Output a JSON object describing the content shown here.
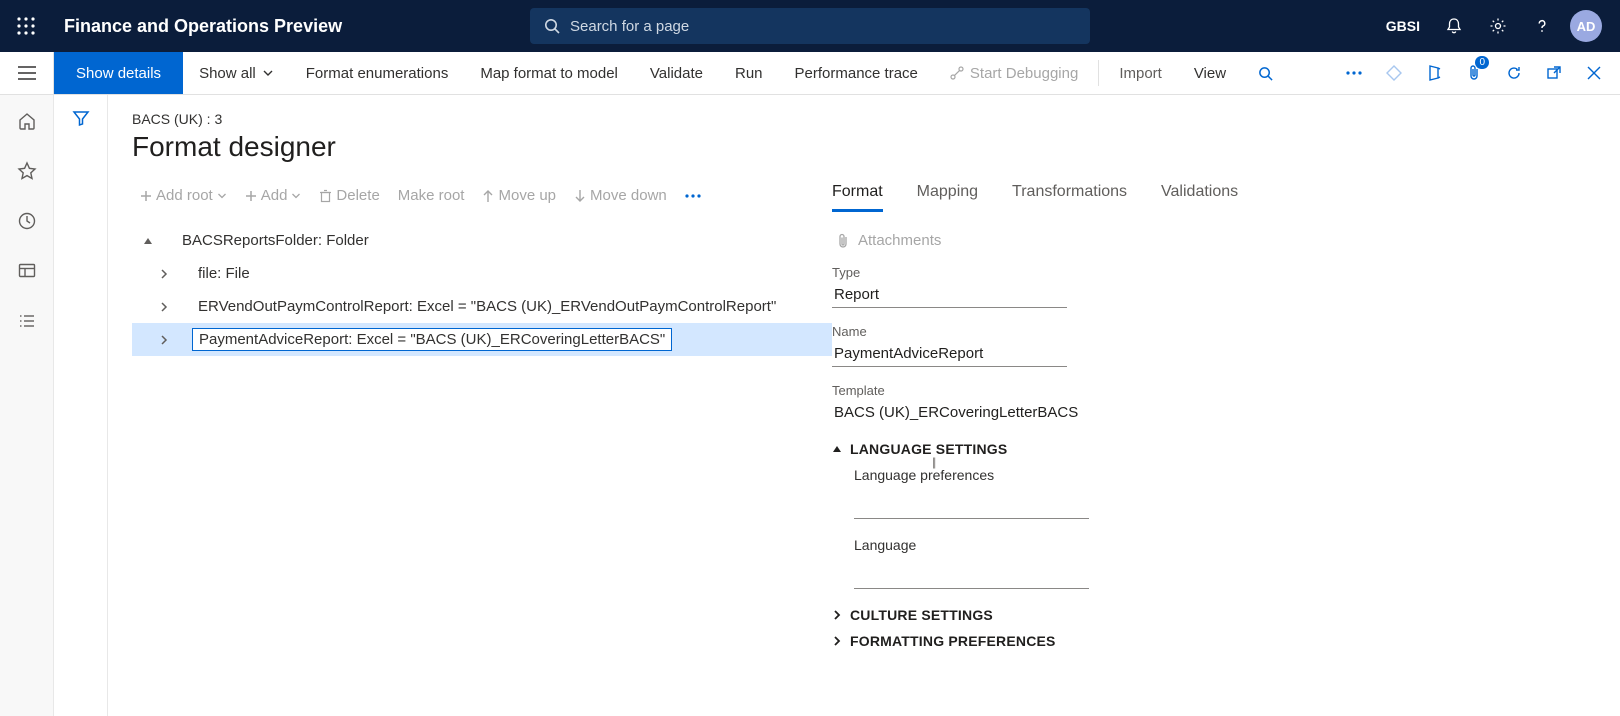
{
  "topbar": {
    "app_title": "Finance and Operations Preview",
    "search_placeholder": "Search for a page",
    "company": "GBSI",
    "avatar_initials": "AD"
  },
  "actionpane": {
    "primary": "Show details",
    "show_all": "Show all",
    "items": [
      "Format enumerations",
      "Map format to model",
      "Validate",
      "Run",
      "Performance trace"
    ],
    "debug": "Start Debugging",
    "import": "Import",
    "view": "View",
    "attach_badge": "0"
  },
  "page": {
    "breadcrumb": "BACS (UK) : 3",
    "title": "Format designer"
  },
  "tree_toolbar": {
    "add_root": "Add root",
    "add": "Add",
    "delete": "Delete",
    "make_root": "Make root",
    "move_up": "Move up",
    "move_down": "Move down"
  },
  "tree": {
    "0": {
      "label": "BACSReportsFolder: Folder"
    },
    "1": {
      "label": "file: File"
    },
    "2": {
      "label": "ERVendOutPaymControlReport: Excel = \"BACS (UK)_ERVendOutPaymControlReport\""
    },
    "3": {
      "label": "PaymentAdviceReport: Excel = \"BACS (UK)_ERCoveringLetterBACS\""
    }
  },
  "tabs": {
    "0": "Format",
    "1": "Mapping",
    "2": "Transformations",
    "3": "Validations"
  },
  "props": {
    "attachments": "Attachments",
    "type_label": "Type",
    "type_value": "Report",
    "name_label": "Name",
    "name_value": "PaymentAdviceReport",
    "template_label": "Template",
    "template_value": "BACS (UK)_ERCoveringLetterBACS",
    "lang_settings": "LANGUAGE SETTINGS",
    "lang_pref": "Language preferences",
    "language": "Language",
    "culture_settings": "CULTURE SETTINGS",
    "formatting_prefs": "FORMATTING PREFERENCES"
  }
}
